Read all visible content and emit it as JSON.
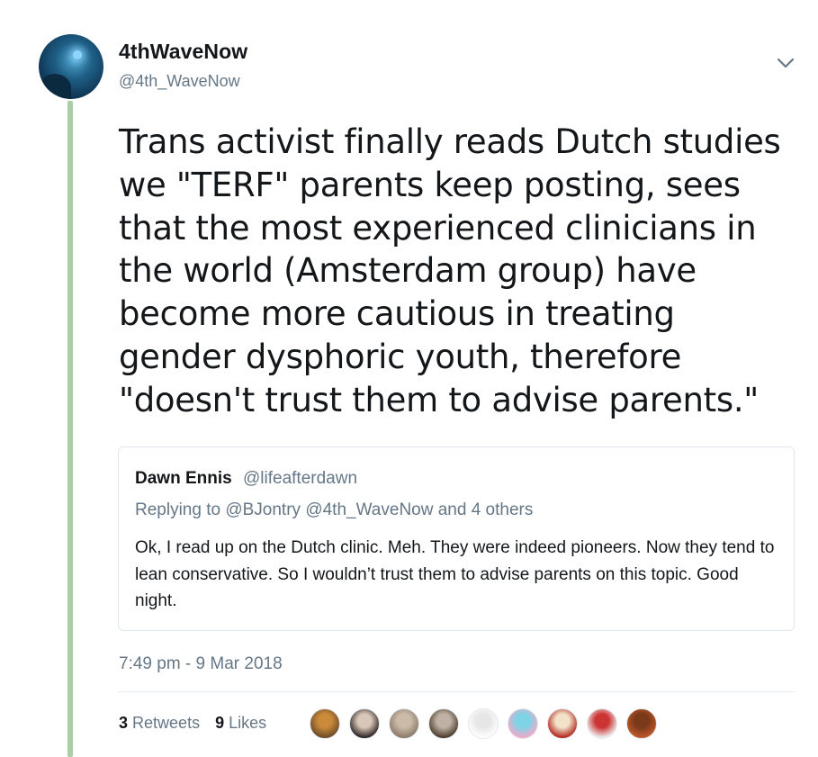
{
  "author": {
    "display_name": "4thWaveNow",
    "handle": "@4th_WaveNow"
  },
  "tweet": {
    "text": "Trans activist finally reads Dutch studies we \"TERF\" parents keep posting, sees that the most experienced clinicians in the world (Amsterdam group) have become more cautious in treating gender dysphoric youth, therefore \"doesn't trust them to advise parents.\"",
    "timestamp": "7:49 pm - 9 Mar 2018"
  },
  "quoted_tweet": {
    "display_name": "Dawn Ennis",
    "handle": "@lifeafterdawn",
    "replying_to": "Replying to @BJontry @4th_WaveNow and 4 others",
    "text": "Ok, I read up on the Dutch clinic. Meh. They were indeed pioneers. Now they tend to lean conservative. So I wouldn’t trust them to advise parents on this topic. Good night."
  },
  "stats": {
    "retweets_count": "3",
    "retweets_label": "Retweets",
    "likes_count": "9",
    "likes_label": "Likes"
  },
  "icons": {
    "menu": "chevron-down-icon"
  },
  "colors": {
    "thread_line": "#aacfa4",
    "secondary_text": "#657786",
    "primary_text": "#14171a",
    "border": "#e1e8ed"
  },
  "likers": [
    {
      "colors": [
        "#6b4a2a",
        "#c98a3a"
      ]
    },
    {
      "colors": [
        "#2a2220",
        "#d8c6b8"
      ]
    },
    {
      "colors": [
        "#8a7868",
        "#cbbba8"
      ]
    },
    {
      "colors": [
        "#4a3a2a",
        "#bfb2a4"
      ]
    },
    {
      "colors": [
        "#ffffff",
        "#e6e6e6"
      ]
    },
    {
      "colors": [
        "#f3a9c8",
        "#7fd3e6"
      ]
    },
    {
      "colors": [
        "#b3241c",
        "#f2e2c8"
      ]
    },
    {
      "colors": [
        "#f0f0f0",
        "#cc3333"
      ]
    },
    {
      "colors": [
        "#c0582a",
        "#7a3a1a"
      ]
    }
  ]
}
